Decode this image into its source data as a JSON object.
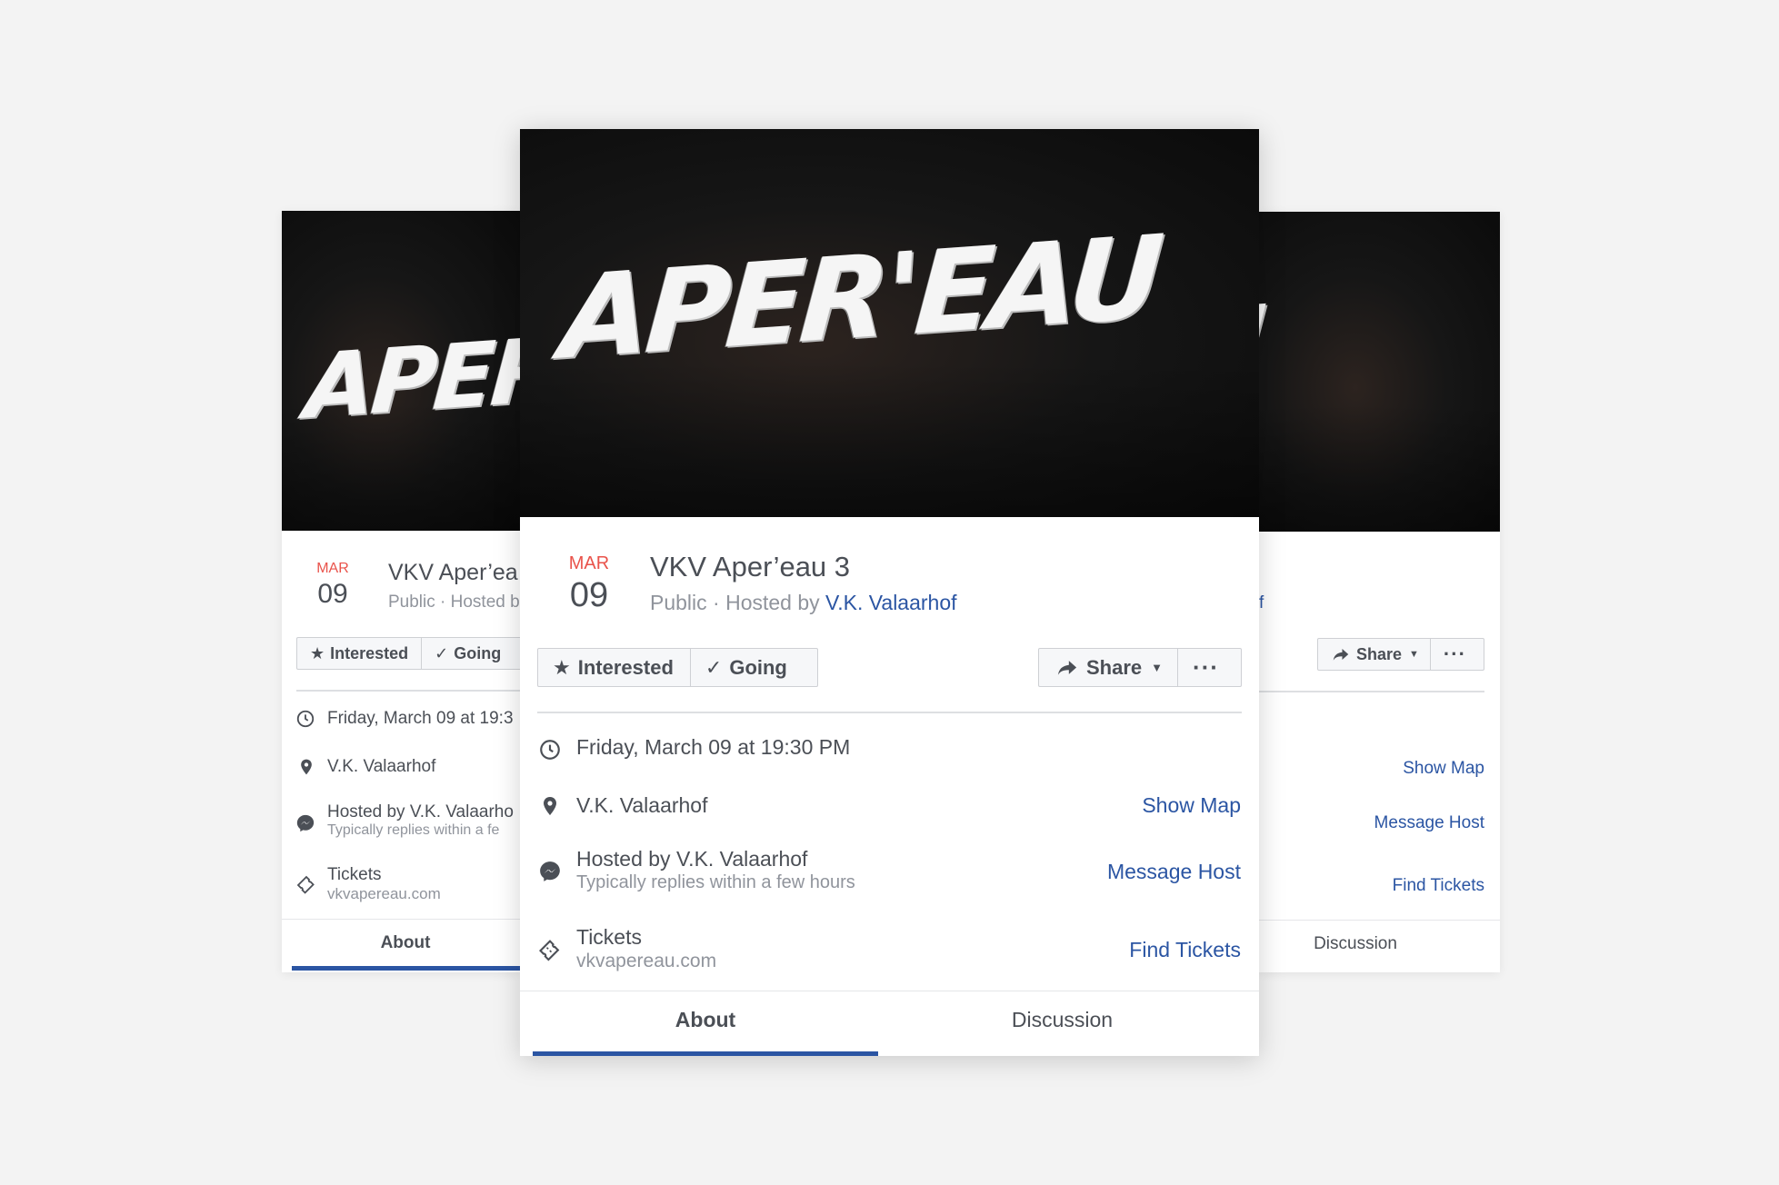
{
  "colors": {
    "accent": "#2b55a3",
    "date_month": "#e9534b",
    "background": "#f3f3f3"
  },
  "event": {
    "cover_text": "APER'EAU",
    "month": "MAR",
    "day": "09",
    "title": "VKV Aper’eau 3",
    "privacy_prefix": "Public · Hosted by ",
    "host": "V.K. Valaarhof",
    "left_title": "VKV Aper’ea",
    "left_sub": "Public · Hosted b",
    "right_sub_fragment": "f"
  },
  "actions": {
    "interested": "Interested",
    "going": "Going",
    "share": "Share",
    "more": "···"
  },
  "details": {
    "datetime": "Friday, March 09 at 19:30 PM",
    "datetime_left": "Friday, March 09 at 19:3",
    "location": "V.K. Valaarhof",
    "show_map": "Show Map",
    "hosted_by": "Hosted by V.K. Valaarhof",
    "hosted_by_left": "Hosted by V.K. Valaarho",
    "replies": "Typically replies within a few hours",
    "replies_left": "Typically replies within a fe",
    "message_host": "Message Host",
    "tickets": "Tickets",
    "tickets_url": "vkvapereau.com",
    "find_tickets": "Find Tickets"
  },
  "tabs": {
    "about": "About",
    "discussion": "Discussion"
  },
  "icons": [
    "star-icon",
    "check-icon",
    "share-arrow-icon",
    "caret-down-icon",
    "more-icon",
    "clock-icon",
    "location-pin-icon",
    "messenger-icon",
    "ticket-icon"
  ]
}
